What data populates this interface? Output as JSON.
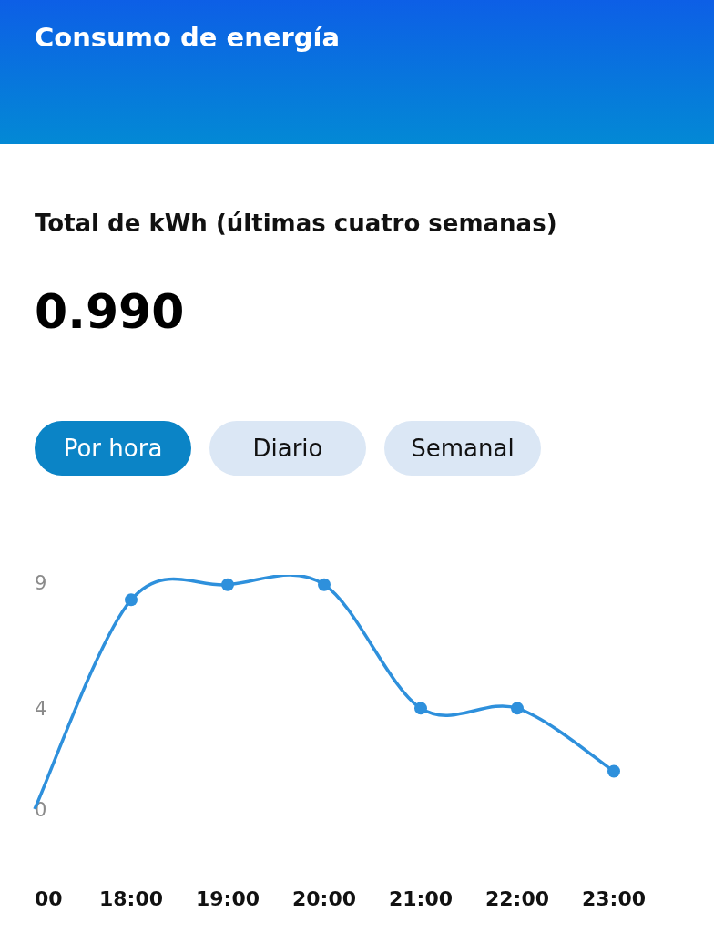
{
  "header": {
    "title": "Consumo de energía"
  },
  "summary": {
    "label": "Total de kWh (últimas cuatro semanas)",
    "value": "0.990"
  },
  "tabs": [
    {
      "label": "Por hora",
      "selected": true
    },
    {
      "label": "Diario",
      "selected": false
    },
    {
      "label": "Semanal",
      "selected": false
    }
  ],
  "chart": {
    "chart_data": {
      "type": "line",
      "categories": [
        "00",
        "18:00",
        "19:00",
        "20:00",
        "21:00",
        "22:00",
        "23:00"
      ],
      "series": [
        {
          "color": "#2e90dc",
          "marker": true,
          "values": [
            0,
            8.3,
            8.9,
            8.9,
            4,
            4,
            1.5
          ]
        }
      ],
      "ylim": [
        0,
        9
      ],
      "yticks": [
        0,
        4,
        9
      ]
    }
  }
}
